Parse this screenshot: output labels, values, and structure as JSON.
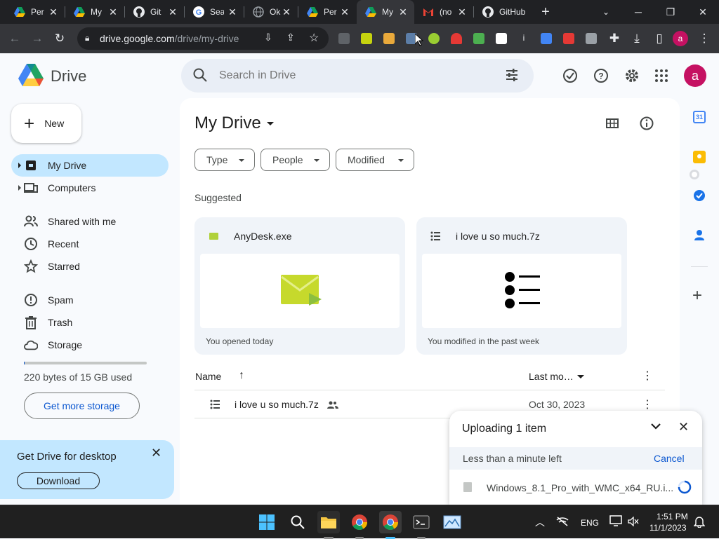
{
  "browser": {
    "tabs": [
      {
        "title": "Per",
        "icon": "google-drive-icon"
      },
      {
        "title": "My",
        "icon": "google-drive-icon"
      },
      {
        "title": "Git",
        "icon": "github-icon"
      },
      {
        "title": "Sea",
        "icon": "google-icon"
      },
      {
        "title": "Ok",
        "icon": "globe-icon"
      },
      {
        "title": "Per",
        "icon": "google-drive-icon"
      },
      {
        "title": "My",
        "icon": "google-drive-icon",
        "active": true
      },
      {
        "title": "(no",
        "icon": "gmail-icon"
      },
      {
        "title": "GitHub",
        "icon": "github-icon"
      }
    ],
    "url_host": "drive.google.com",
    "url_path": "/drive/my-drive"
  },
  "drive": {
    "logo_text": "Drive",
    "search_placeholder": "Search in Drive",
    "avatar_letter": "a",
    "new_button": "New",
    "nav": [
      {
        "label": "My Drive",
        "icon": "my-drive-icon",
        "active": true
      },
      {
        "label": "Computers",
        "icon": "computers-icon"
      },
      {
        "label": "Shared with me",
        "icon": "people-icon"
      },
      {
        "label": "Recent",
        "icon": "clock-icon"
      },
      {
        "label": "Starred",
        "icon": "star-icon"
      },
      {
        "label": "Spam",
        "icon": "spam-icon"
      },
      {
        "label": "Trash",
        "icon": "trash-icon"
      },
      {
        "label": "Storage",
        "icon": "cloud-icon"
      }
    ],
    "storage_text": "220 bytes of 15 GB used",
    "storage_fraction": 0.0,
    "get_more_storage": "Get more storage",
    "desktop_promo": {
      "title": "Get Drive for desktop",
      "button": "Download"
    },
    "page_title": "My Drive",
    "filters": [
      "Type",
      "People",
      "Modified"
    ],
    "suggested_label": "Suggested",
    "suggested": [
      {
        "name": "AnyDesk.exe",
        "footer": "You opened today",
        "icon": "anydesk-icon"
      },
      {
        "name": "i love u so much.7z",
        "footer": "You modified in the past week",
        "icon": "list-icon"
      }
    ],
    "table": {
      "col_name": "Name",
      "col_modified": "Last mo…",
      "rows": [
        {
          "name": "i love u so much.7z",
          "modified": "Oct 30, 2023",
          "shared": true
        }
      ]
    },
    "upload": {
      "title": "Uploading 1 item",
      "status": "Less than a minute left",
      "cancel": "Cancel",
      "file": "Windows_8.1_Pro_with_WMC_x64_RU.i..."
    }
  },
  "taskbar": {
    "lang": "ENG",
    "time": "1:51 PM",
    "date": "11/1/2023"
  },
  "colors": {
    "accent": "#0b57d0",
    "active_nav": "#c2e7ff",
    "avatar": "#c51162"
  }
}
